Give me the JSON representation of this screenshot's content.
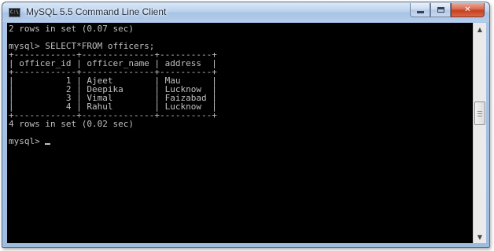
{
  "window": {
    "title": "MySQL 5.5 Command Line Client",
    "icon": "mysql-console-icon",
    "controls": {
      "minimize": "minimize-icon",
      "maximize": "maximize-icon",
      "close": "✕"
    }
  },
  "console": {
    "lines": [
      "2 rows in set (0.07 sec)",
      "",
      "mysql> SELECT*FROM officers;",
      "+------------+--------------+----------+",
      "| officer_id | officer_name | address  |",
      "+------------+--------------+----------+",
      "|          1 | Ajeet        | Mau      |",
      "|          2 | Deepika      | Lucknow  |",
      "|          3 | Vimal        | Faizabad |",
      "|          4 | Rahul        | Lucknow  |",
      "+------------+--------------+----------+",
      "4 rows in set (0.02 sec)",
      "",
      "mysql> "
    ]
  },
  "colors": {
    "console_bg": "#000000",
    "console_text": "#c0c0c0",
    "close_button": "#c4401f"
  }
}
